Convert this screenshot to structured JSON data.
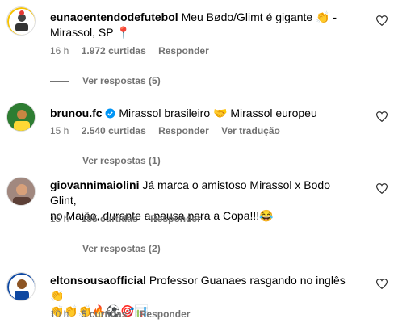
{
  "comments": [
    {
      "username": "eunaoentendodefutebol",
      "text_line1": "Meu Bødo/Glimt é gigante 👏 -",
      "text_line2": "Mirassol, SP 📍",
      "time": "16 h",
      "likes": "1.972 curtidas",
      "reply": "Responder",
      "view_replies": "Ver respostas (5)"
    },
    {
      "username": "brunou.fc",
      "text": "Mirassol brasileiro 🤝 Mirassol europeu",
      "time": "15 h",
      "likes": "2.540 curtidas",
      "reply": "Responder",
      "translate": "Ver tradução",
      "view_replies": "Ver respostas (1)"
    },
    {
      "username": "giovannimaiolini",
      "text_line1": "Já marca o amistoso Mirassol x Bodo Glint,",
      "text_line2": "no Maião, durante a pausa para a Copa!!!😂",
      "time": "15 h",
      "likes": "155 curtidas",
      "reply": "Responder",
      "view_replies": "Ver respostas (2)"
    },
    {
      "username": "eltonsousaofficial",
      "text_line1": "Professor Guanaes rasgando no inglês 👏",
      "text_line2": "👏👏👏🔥⚽🎯📊",
      "time": "10 h",
      "likes": "5 curtidas",
      "reply": "Responder"
    }
  ],
  "colors": {
    "meta": "#737373",
    "verified": "#0095f6"
  }
}
